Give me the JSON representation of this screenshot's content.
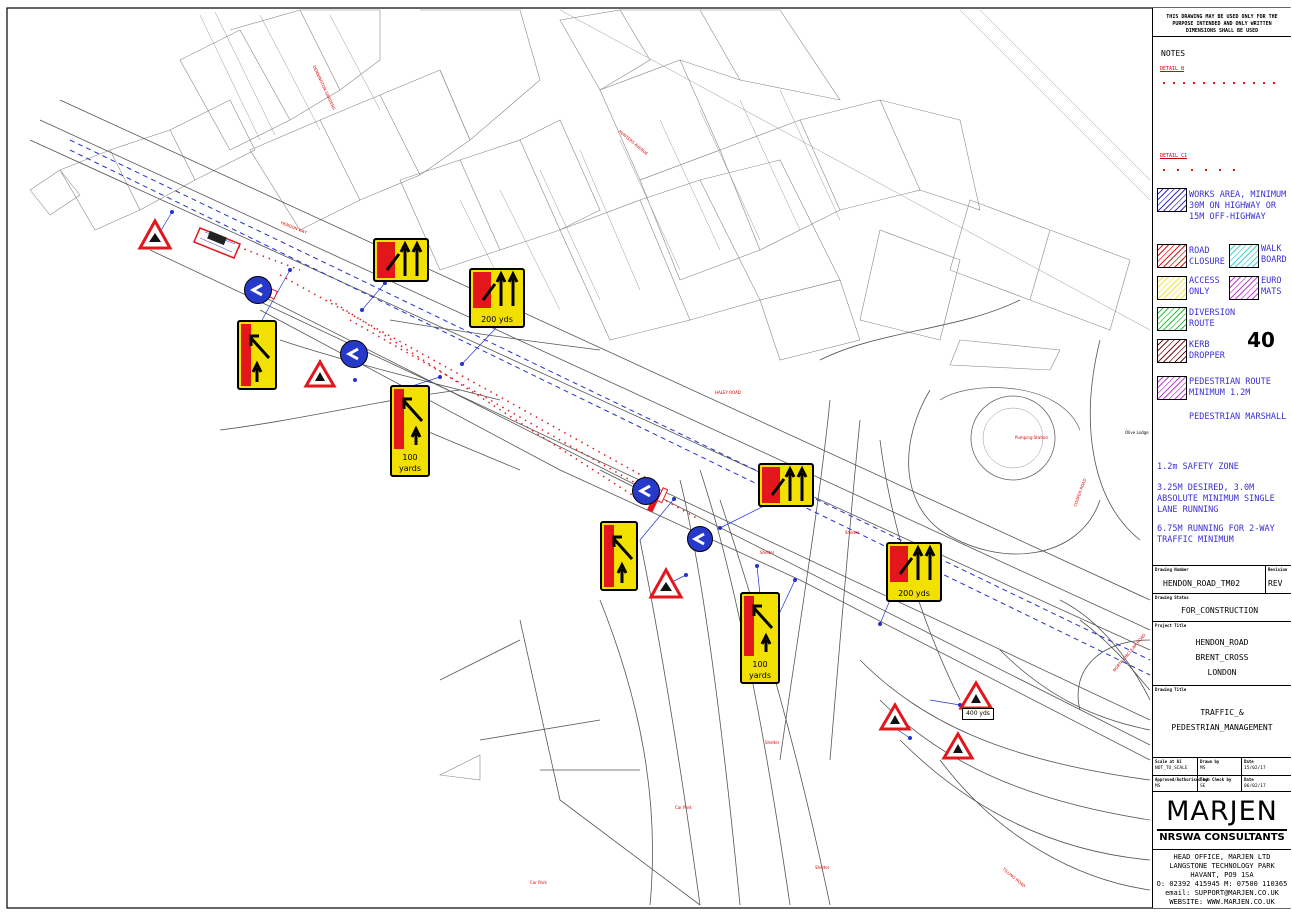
{
  "disclaimer": "THIS DRAWING MAY BE USED ONLY FOR THE PURPOSE INTENDED AND ONLY WRITTEN DIMENSIONS SHALL BE USED",
  "notes_title": "NOTES",
  "detail_b": "DETAIL B",
  "detail_c1": "DETAIL C1",
  "legend": {
    "works_area": "WORKS AREA, MINIMUM 30M ON HIGHWAY OR 15M OFF-HIGHWAY",
    "road_closure": "ROAD CLOSURE",
    "walk_board": "WALK BOARD",
    "access_only": "ACCESS ONLY",
    "euro_mats": "EURO MATS",
    "diversion_route": "DIVERSION ROUTE",
    "kerb_dropper": "KERB DROPPER",
    "pedestrian_route": "PEDESTRIAN ROUTE MINIMUM 1.2M",
    "pedestrian_marshall": "PEDESTRIAN MARSHALL",
    "safety_zone": "1.2m SAFETY ZONE",
    "single_lane": "3.25M DESIRED, 3.0M ABSOLUTE MINIMUM SINGLE LANE RUNNING",
    "two_way": "6.75M RUNNING FOR 2-WAY TRAFFIC MINIMUM",
    "speed_limit": "40"
  },
  "colors": {
    "works": "#3b2fd6",
    "road_closure": "#e3171b",
    "walk_board": "#3fd6d6",
    "access_only": "#f2e640",
    "euro_mats": "#c040d0",
    "diversion": "#30c040",
    "kerb": "#7a1a1a",
    "pedestrian": "#c040d0",
    "sign_yellow": "#f2e100",
    "sign_red": "#e3171b",
    "keep_left_blue": "#2639c9"
  },
  "title_block": {
    "drawing_number_label": "Drawing Number",
    "drawing_number": "HENDON_ROAD_TM02",
    "revision_label": "Revision",
    "revision": "REV",
    "status_label": "Drawing Status",
    "status": "FOR_CONSTRUCTION",
    "project_label": "Project Title",
    "project_1": "HENDON_ROAD",
    "project_2": "BRENT_CROSS",
    "project_3": "LONDON",
    "drawing_title_label": "Drawing Title",
    "title_1": "TRAFFIC_&",
    "title_2": "PEDESTRIAN_MANAGEMENT",
    "scale_label": "Scale at A1",
    "scale": "NOT_TO_SCALE",
    "drawn_label": "Drawn by",
    "drawn": "MS",
    "date_label": "Date",
    "date_1": "15/02/17",
    "approved_label": "Approved/Authorised by",
    "approved": "MS",
    "tech_label": "Tech Check by",
    "tech": "SE",
    "date_2": "06/02/17"
  },
  "company": {
    "name": "MARJEN",
    "sub": "NRSWA CONSULTANTS",
    "addr_1": "HEAD OFFICE, MARJEN LTD",
    "addr_2": "LANGSTONE TECHNOLOGY PARK",
    "addr_3": "HAVANT, PO9 1SA",
    "phone": "O: 02392 415945  M: 07500 110365",
    "email": "email: SUPPORT@MARJEN.CO.UK",
    "website": "WEBSITE: WWW.MARJEN.CO.UK"
  },
  "signs": {
    "yds_200": "200 yds",
    "yards_100_a": "100",
    "yards_100_b": "yards",
    "yds_400": "400 yds"
  },
  "map_labels": {
    "hendon_way": "HENDON WAY",
    "wessex_gardens": "DENNINGTON GARDENS",
    "hunters": "HUNTERS AVENUE",
    "ambleside": "AMBLESIDE",
    "haley_road": "HALEY ROAD",
    "car_park_1": "Car Park",
    "car_park_2": "Car Park",
    "north_circular": "NORTH CIRCULAR ROAD",
    "tilling_road": "TILLING ROAD",
    "olive_lodge": "Olive Lodge",
    "shelter_1": "Shelter",
    "shelter_2": "Shelter",
    "shelter_3": "Shelter",
    "shelter_4": "Shelter",
    "cooper_road": "COOPER ROAD",
    "pumping_station": "Pumping Station"
  }
}
